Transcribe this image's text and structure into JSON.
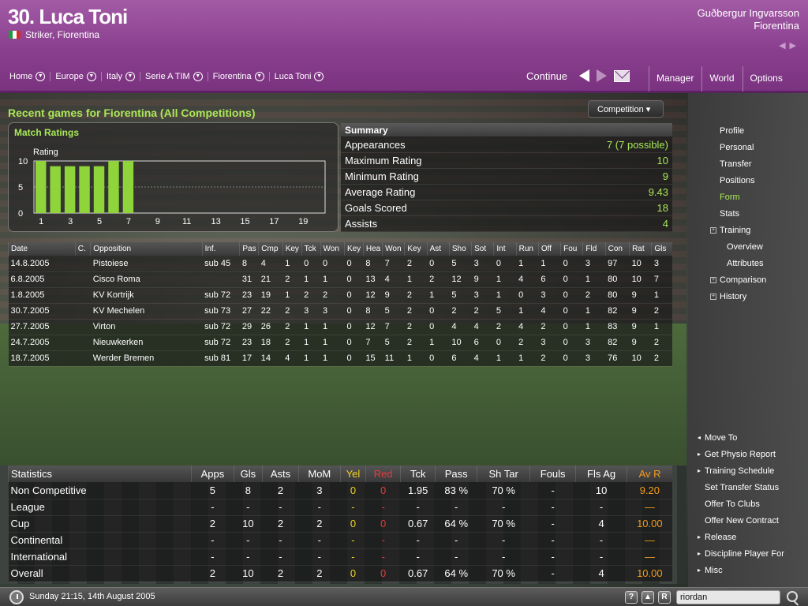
{
  "header": {
    "player_title": "30. Luca Toni",
    "player_subtitle": "Striker, Fiorentina",
    "manager_name": "Guðbergur Ingvarsson",
    "manager_club": "Fiorentina"
  },
  "breadcrumb": [
    "Home",
    "Europe",
    "Italy",
    "Serie A TIM",
    "Fiorentina",
    "Luca Toni"
  ],
  "controls": {
    "continue_label": "Continue"
  },
  "top_nav": [
    "Manager",
    "World",
    "Options"
  ],
  "section_title": "Recent games for Fiorentina (All Competitions)",
  "competition_button": "Competition ▾",
  "chart_data": {
    "type": "bar",
    "title": "Match Ratings",
    "ylabel": "Rating",
    "categories": [
      1,
      2,
      3,
      4,
      5,
      6,
      7,
      8,
      9,
      10,
      11,
      12,
      13,
      14,
      15,
      16,
      17,
      18,
      19,
      20
    ],
    "x_tick_labels": [
      "1",
      "3",
      "5",
      "7",
      "9",
      "11",
      "13",
      "15",
      "17",
      "19"
    ],
    "y_tick_labels": [
      "10",
      "5",
      "0"
    ],
    "values": [
      10,
      9,
      9,
      9,
      9,
      10,
      10
    ],
    "ylim": [
      0,
      10
    ],
    "bar_color": "#8fd43a"
  },
  "summary": {
    "title": "Summary",
    "rows": [
      {
        "label": "Appearances",
        "value": "7 (7 possible)"
      },
      {
        "label": "Maximum Rating",
        "value": "10"
      },
      {
        "label": "Minimum Rating",
        "value": "9"
      },
      {
        "label": "Average Rating",
        "value": "9.43"
      },
      {
        "label": "Goals Scored",
        "value": "18"
      },
      {
        "label": "Assists",
        "value": "4"
      }
    ]
  },
  "games": {
    "columns": [
      "Date",
      "C.",
      "Opposition",
      "Inf.",
      "Pas",
      "Cmp",
      "Key",
      "Tck",
      "Won",
      "Key",
      "Hea",
      "Won",
      "Key",
      "Ast",
      "Sho",
      "Sot",
      "Int",
      "Run",
      "Off",
      "Fou",
      "Fld",
      "Con",
      "Rat",
      "Gls"
    ],
    "rows": [
      [
        "14.8.2005",
        "",
        "Pistoiese",
        "sub 45",
        "8",
        "4",
        "1",
        "0",
        "0",
        "0",
        "8",
        "7",
        "2",
        "0",
        "5",
        "3",
        "0",
        "1",
        "1",
        "0",
        "3",
        "97",
        "10",
        "3"
      ],
      [
        "6.8.2005",
        "",
        "Cisco Roma",
        "",
        "31",
        "21",
        "2",
        "1",
        "1",
        "0",
        "13",
        "4",
        "1",
        "2",
        "12",
        "9",
        "1",
        "4",
        "6",
        "0",
        "1",
        "80",
        "10",
        "7"
      ],
      [
        "1.8.2005",
        "",
        "KV Kortrijk",
        "sub 72",
        "23",
        "19",
        "1",
        "2",
        "2",
        "0",
        "12",
        "9",
        "2",
        "1",
        "5",
        "3",
        "1",
        "0",
        "3",
        "0",
        "2",
        "80",
        "9",
        "1"
      ],
      [
        "30.7.2005",
        "",
        "KV Mechelen",
        "sub 73",
        "27",
        "22",
        "2",
        "3",
        "3",
        "0",
        "8",
        "5",
        "2",
        "0",
        "2",
        "2",
        "5",
        "1",
        "4",
        "0",
        "1",
        "82",
        "9",
        "2"
      ],
      [
        "27.7.2005",
        "",
        "Virton",
        "sub 72",
        "29",
        "26",
        "2",
        "1",
        "1",
        "0",
        "12",
        "7",
        "2",
        "0",
        "4",
        "4",
        "2",
        "4",
        "2",
        "0",
        "1",
        "83",
        "9",
        "1"
      ],
      [
        "24.7.2005",
        "",
        "Nieuwkerken",
        "sub 72",
        "23",
        "18",
        "2",
        "1",
        "1",
        "0",
        "7",
        "5",
        "2",
        "1",
        "10",
        "6",
        "0",
        "2",
        "3",
        "0",
        "3",
        "82",
        "9",
        "2"
      ],
      [
        "18.7.2005",
        "",
        "Werder Bremen",
        "sub 81",
        "17",
        "14",
        "4",
        "1",
        "1",
        "0",
        "15",
        "11",
        "1",
        "0",
        "6",
        "4",
        "1",
        "1",
        "2",
        "0",
        "3",
        "76",
        "10",
        "2"
      ]
    ]
  },
  "stats": {
    "columns": [
      "Statistics",
      "Apps",
      "Gls",
      "Asts",
      "MoM",
      "Yel",
      "Red",
      "Tck",
      "Pass",
      "Sh Tar",
      "Fouls",
      "Fls Ag",
      "Av R"
    ],
    "rows": [
      [
        "Non Competitive",
        "5",
        "8",
        "2",
        "3",
        "0",
        "0",
        "1.95",
        "83 %",
        "70 %",
        "-",
        "10",
        "9.20"
      ],
      [
        "League",
        "-",
        "-",
        "-",
        "-",
        "-",
        "-",
        "-",
        "-",
        "-",
        "-",
        "-",
        "—"
      ],
      [
        "Cup",
        "2",
        "10",
        "2",
        "2",
        "0",
        "0",
        "0.67",
        "64 %",
        "70 %",
        "-",
        "4",
        "10.00"
      ],
      [
        "Continental",
        "-",
        "-",
        "-",
        "-",
        "-",
        "-",
        "-",
        "-",
        "-",
        "-",
        "-",
        "—"
      ],
      [
        "International",
        "-",
        "-",
        "-",
        "-",
        "-",
        "-",
        "-",
        "-",
        "-",
        "-",
        "-",
        "—"
      ],
      [
        "Overall",
        "2",
        "10",
        "2",
        "2",
        "0",
        "0",
        "0.67",
        "64 %",
        "70 %",
        "-",
        "4",
        "10.00"
      ]
    ]
  },
  "sidebar": [
    {
      "label": "Profile",
      "kind": "item"
    },
    {
      "label": "Personal",
      "kind": "item"
    },
    {
      "label": "Transfer",
      "kind": "item"
    },
    {
      "label": "Positions",
      "kind": "item"
    },
    {
      "label": "Form",
      "kind": "active"
    },
    {
      "label": "Stats",
      "kind": "item"
    },
    {
      "label": "Training",
      "kind": "group"
    },
    {
      "label": "Overview",
      "kind": "sub"
    },
    {
      "label": "Attributes",
      "kind": "sub"
    },
    {
      "label": "Comparison",
      "kind": "group"
    },
    {
      "label": "History",
      "kind": "group"
    }
  ],
  "actions": [
    {
      "label": "Move To",
      "marker": "◂"
    },
    {
      "label": "Get Physio Report",
      "marker": "▸"
    },
    {
      "label": "Training Schedule",
      "marker": "▸"
    },
    {
      "label": "Set Transfer Status",
      "marker": ""
    },
    {
      "label": "Offer To Clubs",
      "marker": ""
    },
    {
      "label": "Offer New Contract",
      "marker": ""
    },
    {
      "label": "Release",
      "marker": "▸"
    },
    {
      "label": "Discipline Player For",
      "marker": "▸"
    },
    {
      "label": "Misc",
      "marker": "▸"
    }
  ],
  "statusbar": {
    "datetime": "Sunday 21:15, 14th August 2005",
    "search_value": "riordan",
    "btn_help": "?",
    "btn_up": "▲",
    "btn_r": "R"
  },
  "colors": {
    "accent": "#a9e857",
    "header": "#8a3f8e",
    "yellow": "#f2d21f",
    "red": "#e33b3b",
    "avr": "#f39b1d"
  }
}
